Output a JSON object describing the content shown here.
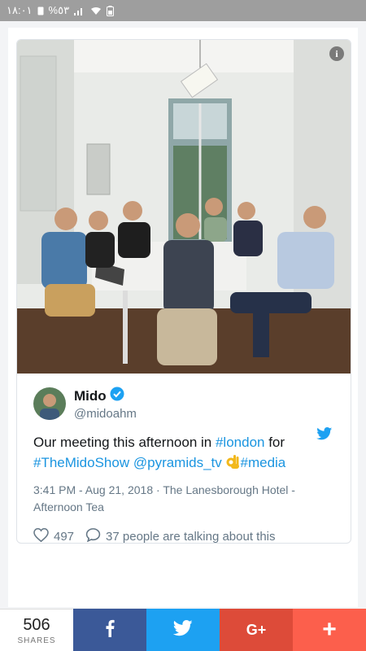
{
  "status_bar": {
    "time": "١٨:٠١",
    "battery": "%٥٣",
    "bg_color": "#9e9e9e"
  },
  "photo": {
    "info_icon": "info-icon",
    "description_icons": [
      "info-icon"
    ]
  },
  "tweet": {
    "display_name": "Mido",
    "handle": "@midoahm",
    "verified_icon": "verified-badge-icon",
    "brand_icon": "twitter-bird-icon",
    "text": {
      "part1": "Our meeting this afternoon in ",
      "hashtag_london": "#london",
      "part2": " for",
      "hashtag_show": "#TheMidoShow",
      "mention": "@pyramids_tv",
      "emoji": "ok-hand-emoji",
      "hashtag_media": "#media"
    },
    "meta": {
      "datetime": "3:41 PM - Aug 21, 2018",
      "separator": " · ",
      "location_line1": "The Lanesborough Hotel -",
      "location_line2": "Afternoon Tea"
    },
    "likes": "497",
    "talking": "37 people are talking about this",
    "link_color": "#1b95e0"
  },
  "share_bar": {
    "count": "506",
    "label": "SHARES",
    "facebook_icon": "facebook-icon",
    "twitter_icon": "twitter-icon",
    "google_plus_label": "G+",
    "more_label": "+",
    "colors": {
      "facebook": "#3b5998",
      "twitter": "#1da1f2",
      "google_plus": "#dd4b39",
      "more": "#fc5f4c"
    }
  }
}
